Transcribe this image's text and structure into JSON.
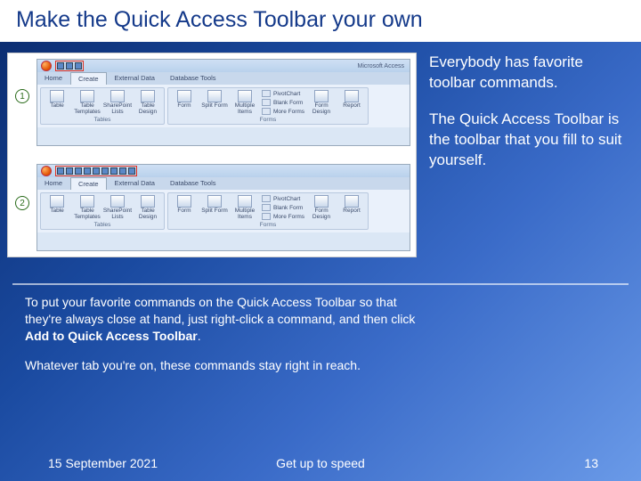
{
  "title": "Make the Quick Access Toolbar your own",
  "side": {
    "p1": "Everybody has favorite toolbar commands.",
    "p2": "The Quick Access Toolbar is the toolbar that you fill to suit yourself."
  },
  "lower": {
    "p1a": "To put your favorite commands on the Quick Access Toolbar so that they're always close at hand, just right-click a command, and then click ",
    "p1b": "Add to Quick Access Toolbar",
    "p1c": ".",
    "p2": "Whatever tab you're on, these commands stay right in reach."
  },
  "footer": {
    "date": "15 September 2021",
    "mid": "Get up to speed",
    "page": "13"
  },
  "screenshot": {
    "callout1": "1",
    "callout2": "2",
    "app_title": "Microsoft Access",
    "tabs": {
      "home": "Home",
      "create": "Create",
      "external": "External Data",
      "dbtools": "Database Tools"
    },
    "groups": {
      "tables": "Tables",
      "forms": "Forms",
      "items": {
        "table": "Table",
        "templates": "Table Templates",
        "sharepoint": "SharePoint Lists",
        "design": "Table Design",
        "form": "Form",
        "split": "Split Form",
        "multi": "Multiple Items",
        "pivot": "PivotChart",
        "blank": "Blank Form",
        "more": "More Forms",
        "formdesign": "Form Design",
        "report": "Report"
      }
    }
  }
}
